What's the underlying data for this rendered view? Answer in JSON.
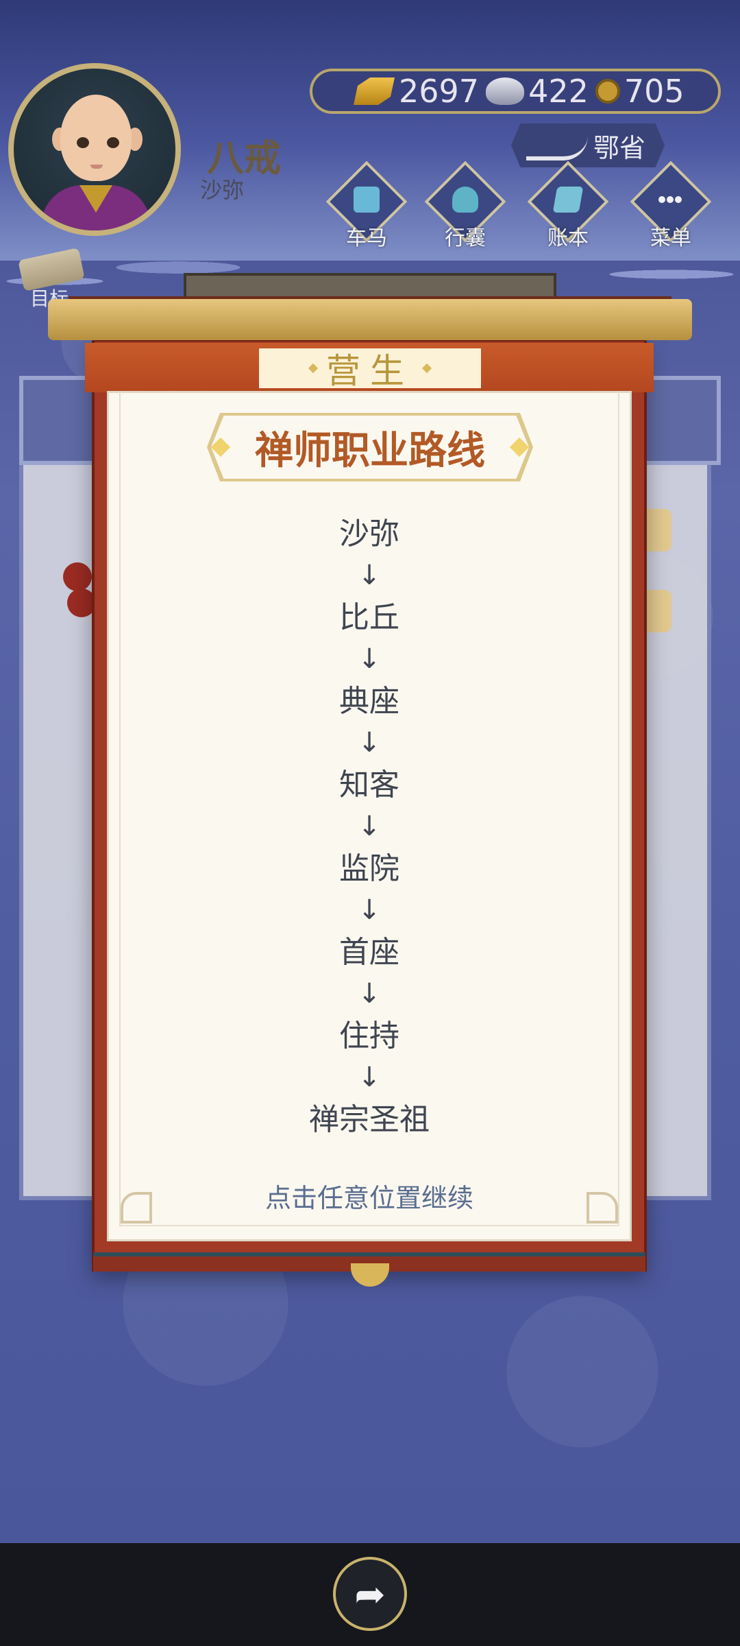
{
  "player": {
    "name": "八戒",
    "rank": "沙弥"
  },
  "resources": {
    "gold": "2697",
    "silver": "422",
    "coins": "705"
  },
  "region": {
    "label": "鄂省"
  },
  "nav": {
    "items": [
      {
        "label": "车马",
        "icon": "carriage-icon"
      },
      {
        "label": "行囊",
        "icon": "bag-icon"
      },
      {
        "label": "账本",
        "icon": "ledger-icon"
      },
      {
        "label": "菜单",
        "icon": "menu-icon"
      }
    ]
  },
  "objective": {
    "label": "目标"
  },
  "modal": {
    "header": "营生",
    "title": "禅师职业路线",
    "career_path": [
      "沙弥",
      "比丘",
      "典座",
      "知客",
      "监院",
      "首座",
      "住持",
      "禅宗圣祖"
    ],
    "arrow": "↓",
    "hint": "点击任意位置继续"
  },
  "colors": {
    "accent_gold": "#b8963c",
    "title_orange": "#b25a26",
    "frame_red": "#a23a25",
    "background_blue": "#5a66a8"
  }
}
